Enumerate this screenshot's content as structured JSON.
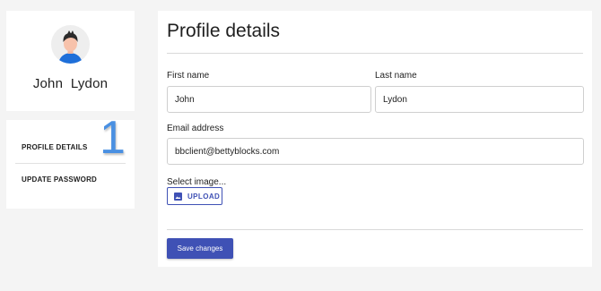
{
  "profile": {
    "display_name": "John  Lydon",
    "avatar_icon": "person-avatar-icon"
  },
  "nav": {
    "step_number": "1",
    "items": [
      {
        "label": "PROFILE DETAILS"
      },
      {
        "label": "UPDATE PASSWORD"
      }
    ]
  },
  "form": {
    "title": "Profile details",
    "first_name": {
      "label": "First name",
      "value": "John"
    },
    "last_name": {
      "label": "Last name",
      "value": "Lydon"
    },
    "email": {
      "label": "Email address",
      "value": "bbclient@bettyblocks.com"
    },
    "image": {
      "label": "Select image...",
      "upload_label": "UPLOAD",
      "upload_icon": "image-icon"
    },
    "save_label": "Save changes"
  },
  "colors": {
    "accent": "#3f51b5",
    "step_number": "#4a90e2",
    "background": "#f4f4f4"
  }
}
